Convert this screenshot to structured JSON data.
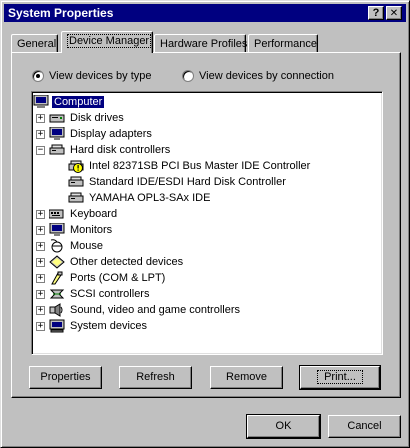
{
  "window": {
    "title": "System Properties",
    "help_btn": "?",
    "close_btn": "✕"
  },
  "tabs": [
    {
      "label": "General",
      "active": false
    },
    {
      "label": "Device Manager",
      "active": true
    },
    {
      "label": "Hardware Profiles",
      "active": false
    },
    {
      "label": "Performance",
      "active": false
    }
  ],
  "view": {
    "by_type": "View devices by type",
    "by_connection": "View devices by connection",
    "selected": "by_type"
  },
  "tree": {
    "root": "Computer",
    "items": [
      {
        "label": "Disk drives",
        "icon": "disk-drive-icon",
        "expander": "+"
      },
      {
        "label": "Display adapters",
        "icon": "monitor-icon",
        "expander": "+"
      },
      {
        "label": "Hard disk controllers",
        "icon": "disk-controller-icon",
        "expander": "-"
      },
      {
        "label": "Intel 82371SB PCI Bus Master IDE Controller",
        "icon": "warning-controller-icon",
        "child": true
      },
      {
        "label": "Standard IDE/ESDI Hard Disk Controller",
        "icon": "disk-controller-icon",
        "child": true
      },
      {
        "label": "YAMAHA OPL3-SAx IDE",
        "icon": "disk-controller-icon",
        "child": true
      },
      {
        "label": "Keyboard",
        "icon": "keyboard-icon",
        "expander": "+"
      },
      {
        "label": "Monitors",
        "icon": "monitor-icon",
        "expander": "+"
      },
      {
        "label": "Mouse",
        "icon": "mouse-icon",
        "expander": "+"
      },
      {
        "label": "Other detected devices",
        "icon": "other-device-icon",
        "expander": "+"
      },
      {
        "label": "Ports (COM & LPT)",
        "icon": "port-icon",
        "expander": "+"
      },
      {
        "label": "SCSI controllers",
        "icon": "scsi-icon",
        "expander": "+"
      },
      {
        "label": "Sound, video and game controllers",
        "icon": "sound-icon",
        "expander": "+"
      },
      {
        "label": "System devices",
        "icon": "system-device-icon",
        "expander": "+"
      }
    ]
  },
  "buttons": {
    "properties": "Properties",
    "refresh": "Refresh",
    "remove": "Remove",
    "print": "Print...",
    "ok": "OK",
    "cancel": "Cancel"
  },
  "colors": {
    "titlebar": "#000080",
    "face": "#c0c0c0",
    "selection": "#000080"
  }
}
